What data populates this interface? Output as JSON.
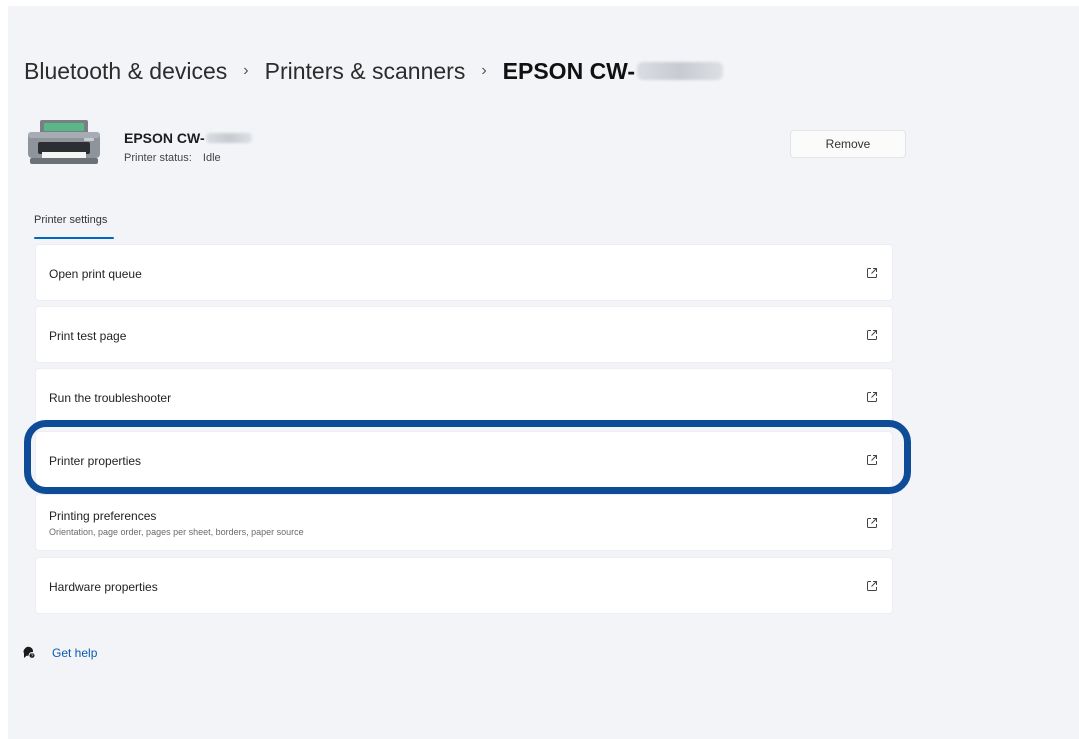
{
  "breadcrumb": {
    "items": [
      "Bluetooth & devices",
      "Printers & scanners"
    ],
    "current": "EPSON CW-",
    "separator": "›"
  },
  "device": {
    "name": "EPSON CW-",
    "status_label": "Printer status:",
    "status_value": "Idle"
  },
  "remove_button": "Remove",
  "section_tab": "Printer settings",
  "settings": [
    {
      "label": "Open print queue",
      "sub": ""
    },
    {
      "label": "Print test page",
      "sub": ""
    },
    {
      "label": "Run the troubleshooter",
      "sub": ""
    },
    {
      "label": "Printer properties",
      "sub": ""
    },
    {
      "label": "Printing preferences",
      "sub": "Orientation, page order, pages per sheet, borders, paper source"
    },
    {
      "label": "Hardware properties",
      "sub": ""
    }
  ],
  "get_help": "Get help",
  "colors": {
    "accent": "#0067c0",
    "highlight": "#0f4c97",
    "background": "#f2f4f7"
  },
  "icons": {
    "row_action": "open-external-icon",
    "help": "help-chat-icon",
    "device": "printer-icon"
  }
}
